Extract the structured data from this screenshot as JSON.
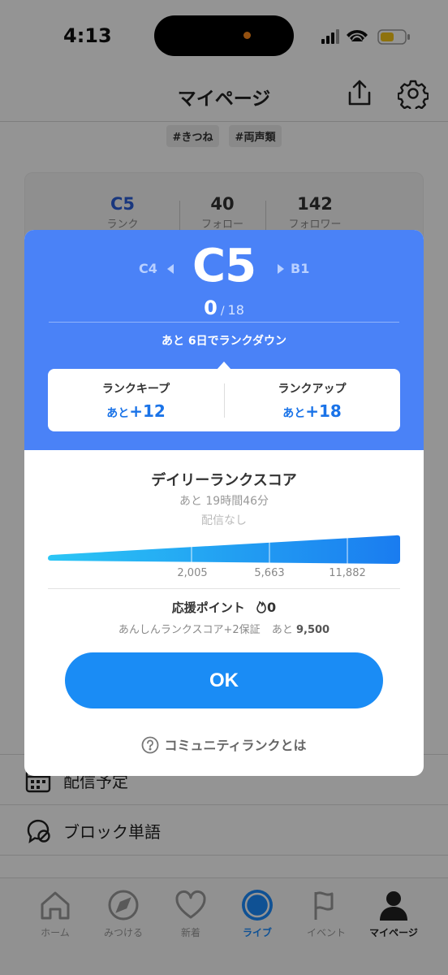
{
  "status_bar": {
    "time": "4:13"
  },
  "header": {
    "title": "マイページ"
  },
  "tags": [
    "#きつね",
    "#両声類"
  ],
  "stats": [
    {
      "value": "C5",
      "label": "ランク"
    },
    {
      "value": "40",
      "label": "フォロー"
    },
    {
      "value": "142",
      "label": "フォロワー"
    }
  ],
  "menu": [
    {
      "label": "配信予定",
      "icon": "calendar-icon"
    },
    {
      "label": "ブロック単語",
      "icon": "blocked-word-icon"
    }
  ],
  "bottom_nav": [
    {
      "label": "ホーム",
      "icon": "home-icon"
    },
    {
      "label": "みつける",
      "icon": "compass-icon"
    },
    {
      "label": "新着",
      "icon": "heart-icon"
    },
    {
      "label": "ライブ",
      "icon": "live-icon"
    },
    {
      "label": "イベント",
      "icon": "flag-icon"
    },
    {
      "label": "マイページ",
      "icon": "person-icon"
    }
  ],
  "modal": {
    "prev_rank": "C4",
    "current_rank": "C5",
    "next_rank": "B1",
    "progress_current": "0",
    "progress_sep": "/",
    "progress_total": "18",
    "rank_down_notice": "あと 6日でランクダウン",
    "keep": {
      "title": "ランクキープ",
      "prefix": "あと",
      "value": "+12"
    },
    "up": {
      "title": "ランクアップ",
      "prefix": "あと",
      "value": "+18"
    },
    "daily_title": "デイリーランクスコア",
    "daily_remaining": "あと 19時間46分",
    "no_stream": "配信なし",
    "score_ticks": [
      "2,005",
      "5,663",
      "11,882"
    ],
    "support_label": "応援ポイント",
    "support_value": "0",
    "support_sub": "あんしんランクスコア+2保証",
    "support_sub_prefix": "あと",
    "support_sub_value": "9,500",
    "ok_label": "OK",
    "help_label": "コミュニティランクとは"
  },
  "colors": {
    "modal_header": "#4a82f7",
    "accent_blue": "#1a8cf5",
    "keep_value": "#1a73e8"
  }
}
